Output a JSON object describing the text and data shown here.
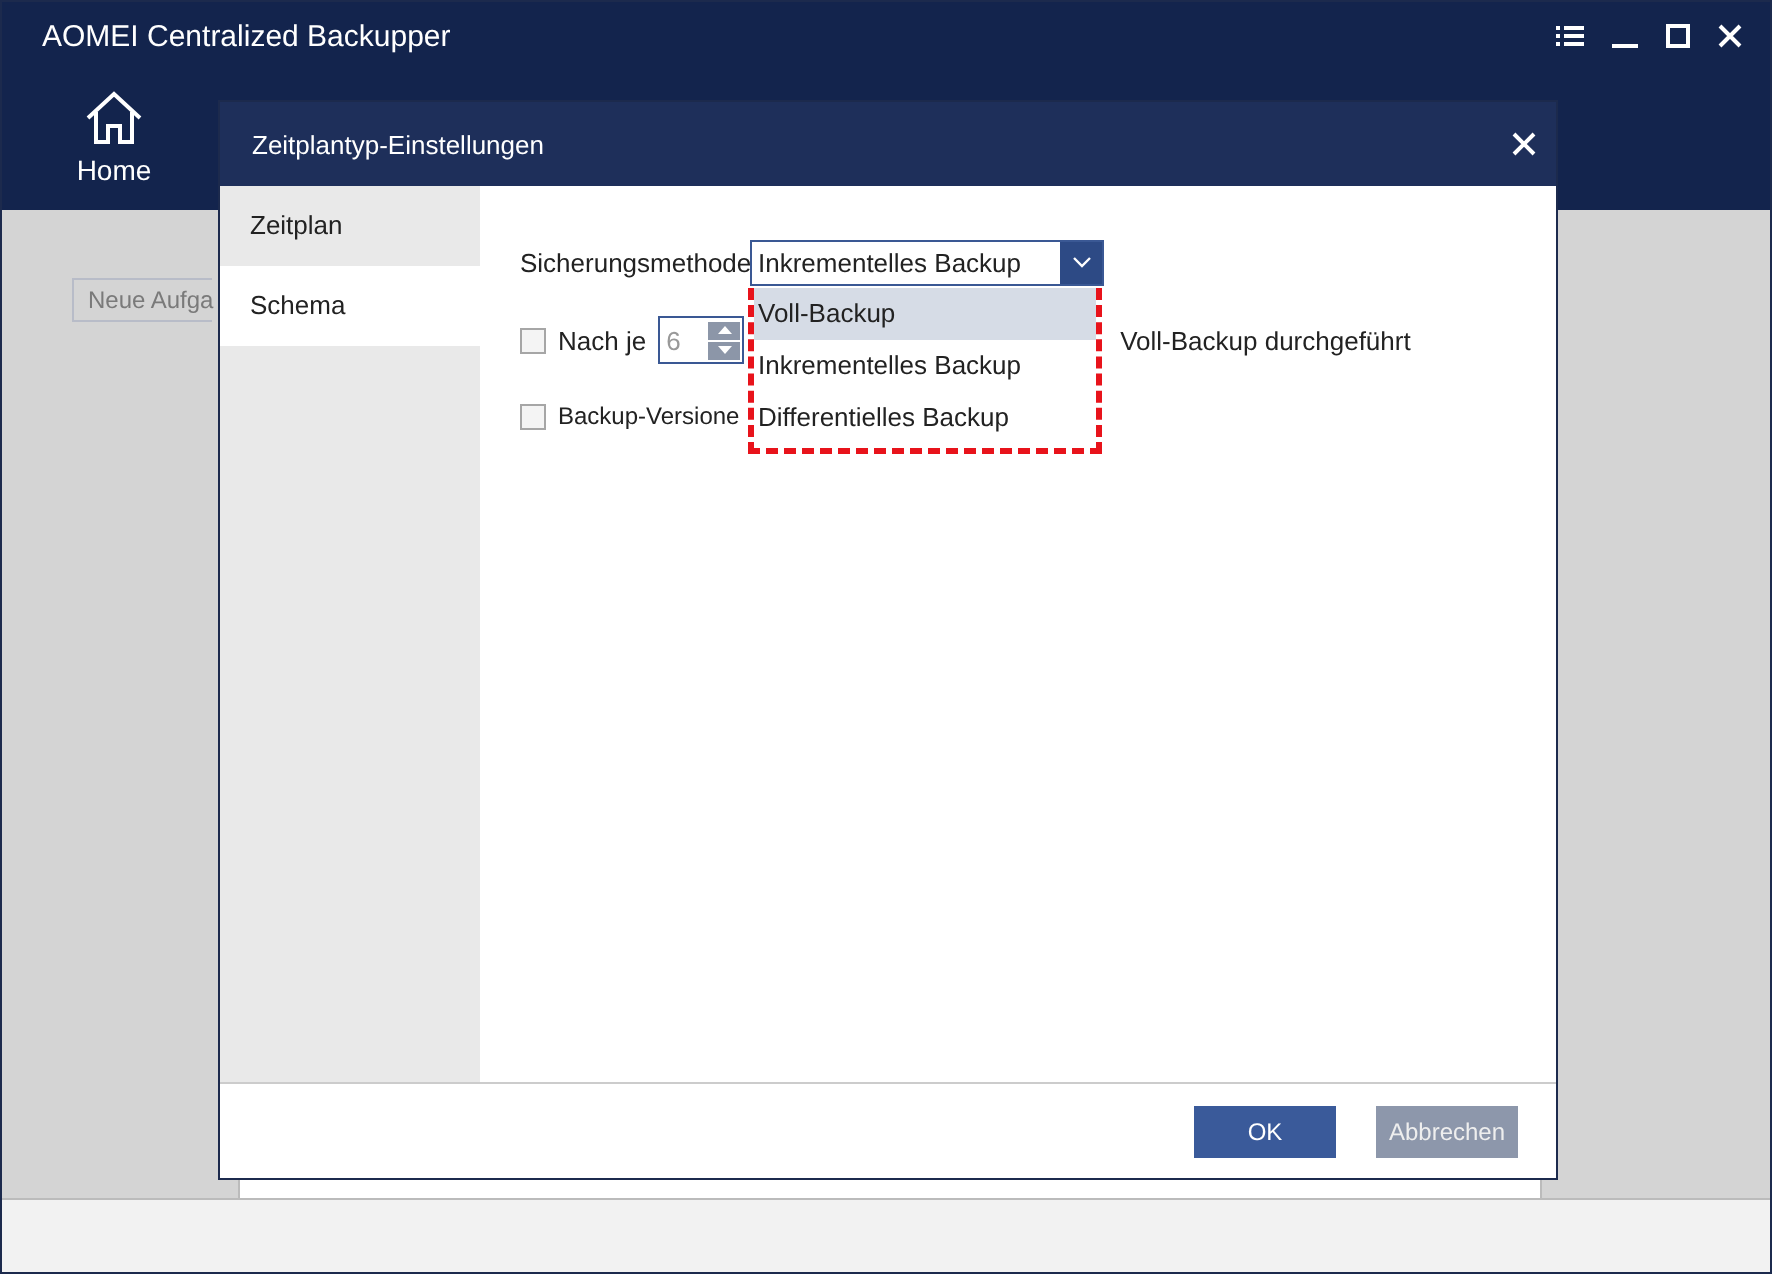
{
  "window": {
    "title": "AOMEI Centralized Backupper"
  },
  "nav": [
    {
      "label": "Home",
      "selected": false
    }
  ],
  "main": {
    "task_button": "Neue Aufga"
  },
  "dialog": {
    "title": "Zeitplantyp-Einstellungen",
    "sidebar": [
      {
        "label": "Zeitplan",
        "selected": false
      },
      {
        "label": "Schema",
        "selected": true
      }
    ],
    "method": {
      "label": "Sicherungsmethode",
      "value": "Inkrementelles Backup",
      "expanded": true,
      "options": [
        {
          "label": "Voll-Backup",
          "highlighted": true
        },
        {
          "label": "Inkrementelles Backup",
          "highlighted": false
        },
        {
          "label": "Differentielles Backup",
          "highlighted": false
        }
      ]
    },
    "full_after": {
      "label": "Nach je",
      "checked": false,
      "value": "6",
      "disabled": true,
      "suffix": "Voll-Backup durchgeführt"
    },
    "versions": {
      "label": "Backup-Versione",
      "checked": false
    },
    "buttons": [
      {
        "label": "OK",
        "disabled": false
      },
      {
        "label": "Abbrechen",
        "disabled": true
      }
    ]
  }
}
